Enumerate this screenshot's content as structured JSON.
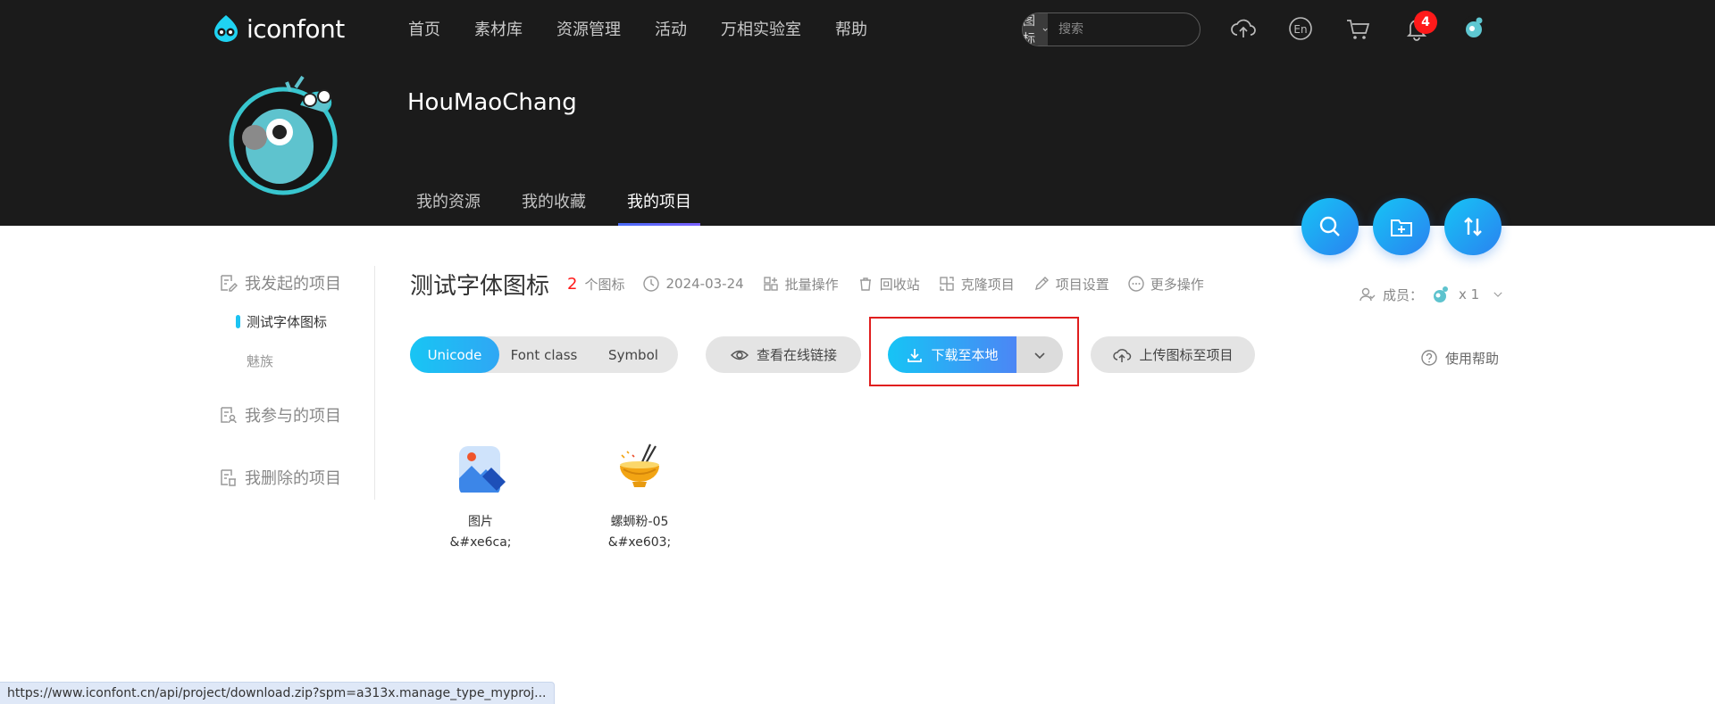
{
  "brand": {
    "name": "iconfont"
  },
  "nav": {
    "links": [
      "首页",
      "素材库",
      "资源管理",
      "活动",
      "万相实验室",
      "帮助"
    ]
  },
  "search": {
    "type_label": "图标",
    "placeholder": "搜索"
  },
  "notifications": {
    "count": "4"
  },
  "profile": {
    "username": "HouMaoChang"
  },
  "tabs": [
    {
      "label": "我的资源",
      "active": false
    },
    {
      "label": "我的收藏",
      "active": false
    },
    {
      "label": "我的项目",
      "active": true
    }
  ],
  "sidebar": {
    "initiated": "我发起的项目",
    "projects": [
      {
        "label": "测试字体图标",
        "active": true
      },
      {
        "label": "魅族",
        "active": false
      }
    ],
    "joined": "我参与的项目",
    "deleted": "我删除的项目"
  },
  "project": {
    "title": "测试字体图标",
    "icon_count": "2",
    "icon_count_unit": "个图标",
    "date": "2024-03-24",
    "actions": [
      "批量操作",
      "回收站",
      "克隆项目",
      "项目设置",
      "更多操作"
    ],
    "members_label": "成员：",
    "members_count": "x 1"
  },
  "toolbar": {
    "formats": [
      "Unicode",
      "Font class",
      "Symbol"
    ],
    "active_format": "Unicode",
    "view_link": "查看在线链接",
    "download": "下载至本地",
    "upload": "上传图标至项目",
    "help": "使用帮助"
  },
  "icons": [
    {
      "name": "图片",
      "code": "&#xe6ca;",
      "icon": "image-icon"
    },
    {
      "name": "螺蛳粉-05",
      "code": "&#xe603;",
      "icon": "noodle-bowl-icon"
    }
  ],
  "status_bar": {
    "url": "https://www.iconfont.cn/api/project/download.zip?spm=a313x.manage_type_myproj..."
  },
  "colors": {
    "header_bg": "#1b1b1b",
    "accent": "#16c4f5",
    "accent_deep": "#2a82f0",
    "count_red": "#ff1a1a",
    "highlight_red": "#e01e1e"
  }
}
